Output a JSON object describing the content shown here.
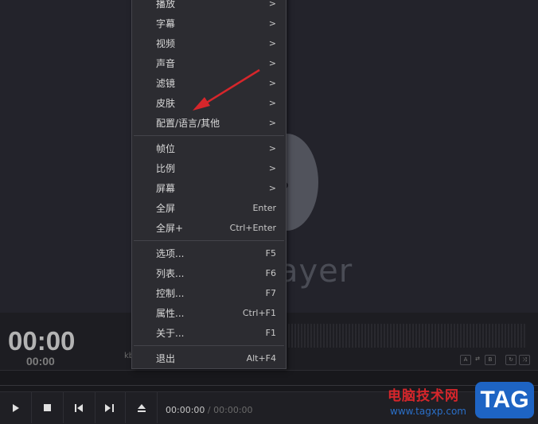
{
  "background_logo": {
    "text": "ayer"
  },
  "info": {
    "time_big": "00:00",
    "time_small": "00:00",
    "kb_label": "kb",
    "mini_buttons": [
      "A",
      "B"
    ]
  },
  "controls": {
    "current_time": "00:00:00",
    "separator": "/",
    "total_time": "00:00:00"
  },
  "menu": {
    "items": [
      {
        "label": "播放",
        "right": ">"
      },
      {
        "label": "字幕",
        "right": ">"
      },
      {
        "label": "视频",
        "right": ">"
      },
      {
        "label": "声音",
        "right": ">"
      },
      {
        "label": "滤镜",
        "right": ">"
      },
      {
        "label": "皮肤",
        "right": ">"
      },
      {
        "label": "配置/语言/其他",
        "right": ">"
      },
      {
        "label": "帧位",
        "right": ">"
      },
      {
        "label": "比例",
        "right": ">"
      },
      {
        "label": "屏幕",
        "right": ">"
      },
      {
        "label": "全屏",
        "right": "Enter"
      },
      {
        "label": "全屏+",
        "right": "Ctrl+Enter"
      },
      {
        "label": "选项...",
        "right": "F5"
      },
      {
        "label": "列表...",
        "right": "F6"
      },
      {
        "label": "控制...",
        "right": "F7"
      },
      {
        "label": "属性...",
        "right": "Ctrl+F1"
      },
      {
        "label": "关于...",
        "right": "F1"
      },
      {
        "label": "退出",
        "right": "Alt+F4"
      }
    ]
  },
  "watermark": {
    "site_name": "电脑技术网",
    "url": "www.tagxp.com",
    "tag": "TAG"
  },
  "colors": {
    "arrow": "#d6262b",
    "menu_bg": "#2c2c31",
    "tag_bg": "#1e64c4"
  }
}
